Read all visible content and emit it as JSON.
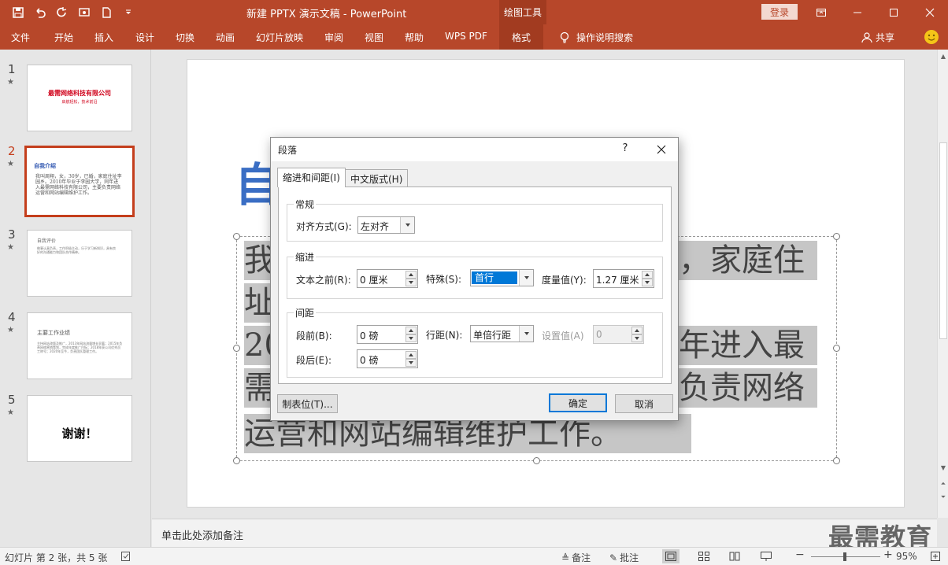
{
  "app": {
    "document_title": "新建 PPTX 演示文稿  -  PowerPoint",
    "context_tool": "绘图工具",
    "login": "登录"
  },
  "ribbon": {
    "tabs": [
      "文件",
      "开始",
      "插入",
      "设计",
      "切换",
      "动画",
      "幻灯片放映",
      "审阅",
      "视图",
      "帮助",
      "WPS PDF",
      "格式"
    ],
    "active_tab": "格式",
    "tell_me": "操作说明搜索",
    "share": "共享"
  },
  "slides": [
    {
      "num": "1",
      "title": "最需网络科技有限公司",
      "subtitle": "启航轻松，技术前沿"
    },
    {
      "num": "2",
      "title": "自我介绍",
      "body": "我叫周翔，女，30岁，已婚，家庭住址李园乡。2010年毕业于李园大学，同年进入最需网络科技有限公司，主要负责网络运营和网站编辑维护工作。"
    },
    {
      "num": "3",
      "title": "自我评价",
      "body": "做事认真负责，工作积极主动，乐于学习新知识，具有良好的沟通能力和团队合作精神。"
    },
    {
      "num": "4",
      "title": "主要工作业绩",
      "body": "主持网站改版及推广，2013年网站流量增长显著；2015年负责网络营销策划，完成年度推广目标；2018年获公司优秀员工称号；2020年至今，负责团队管理工作。"
    },
    {
      "num": "5",
      "title": "谢谢！"
    }
  ],
  "current_slide": {
    "title_visible": "自",
    "body_lines": [
      "我",
      "，家庭住",
      "址",
      "20",
      "年进入最",
      "需",
      "负责网络",
      "运营和网站编辑维护工作。"
    ]
  },
  "notes_placeholder": "单击此处添加备注",
  "watermark": "最需教育",
  "status": {
    "slide_info": "幻灯片 第 2 张，共 5 张",
    "notes_btn": "备注",
    "comments_btn": "批注",
    "zoom": "95%"
  },
  "dialog": {
    "title": "段落",
    "help": "?",
    "tabs": [
      "缩进和间距(I)",
      "中文版式(H)"
    ],
    "groups": {
      "general": "常规",
      "indent": "缩进",
      "spacing": "间距"
    },
    "alignment_label": "对齐方式(G):",
    "alignment_value": "左对齐",
    "before_text_label": "文本之前(R):",
    "before_text_value": "0 厘米",
    "special_label": "特殊(S):",
    "special_value": "首行",
    "by_label": "度量值(Y):",
    "by_value": "1.27 厘米",
    "before_label": "段前(B):",
    "before_value": "0 磅",
    "line_spacing_label": "行距(N):",
    "line_spacing_value": "单倍行距",
    "at_label": "设置值(A)",
    "at_value": "0",
    "after_label": "段后(E):",
    "after_value": "0 磅",
    "tabs_button": "制表位(T)...",
    "ok": "确定",
    "cancel": "取消"
  }
}
